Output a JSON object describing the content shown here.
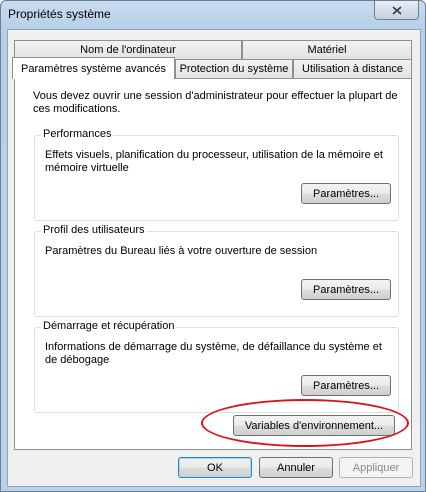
{
  "window": {
    "title": "Propriétés système"
  },
  "tabs": {
    "row1": [
      "Nom de l'ordinateur",
      "Matériel"
    ],
    "row2": [
      "Paramètres système avancés",
      "Protection du système",
      "Utilisation à distance"
    ],
    "active": "Paramètres système avancés"
  },
  "intro_text": "Vous devez ouvrir une session d'administrateur pour effectuer la plupart de ces modifications.",
  "groups": {
    "performances": {
      "label": "Performances",
      "text": "Effets visuels, planification du processeur, utilisation de la mémoire et mémoire virtuelle",
      "button": "Paramètres..."
    },
    "profil": {
      "label": "Profil des utilisateurs",
      "text": "Paramètres du Bureau liés à votre ouverture de session",
      "button": "Paramètres..."
    },
    "demarrage": {
      "label": "Démarrage et récupération",
      "text": "Informations de démarrage du système, de défaillance du système et de débogage",
      "button": "Paramètres..."
    }
  },
  "env_button": "Variables d'environnement...",
  "footer": {
    "ok": "OK",
    "cancel": "Annuler",
    "apply": "Appliquer"
  },
  "annotation_color": "#d8141b"
}
